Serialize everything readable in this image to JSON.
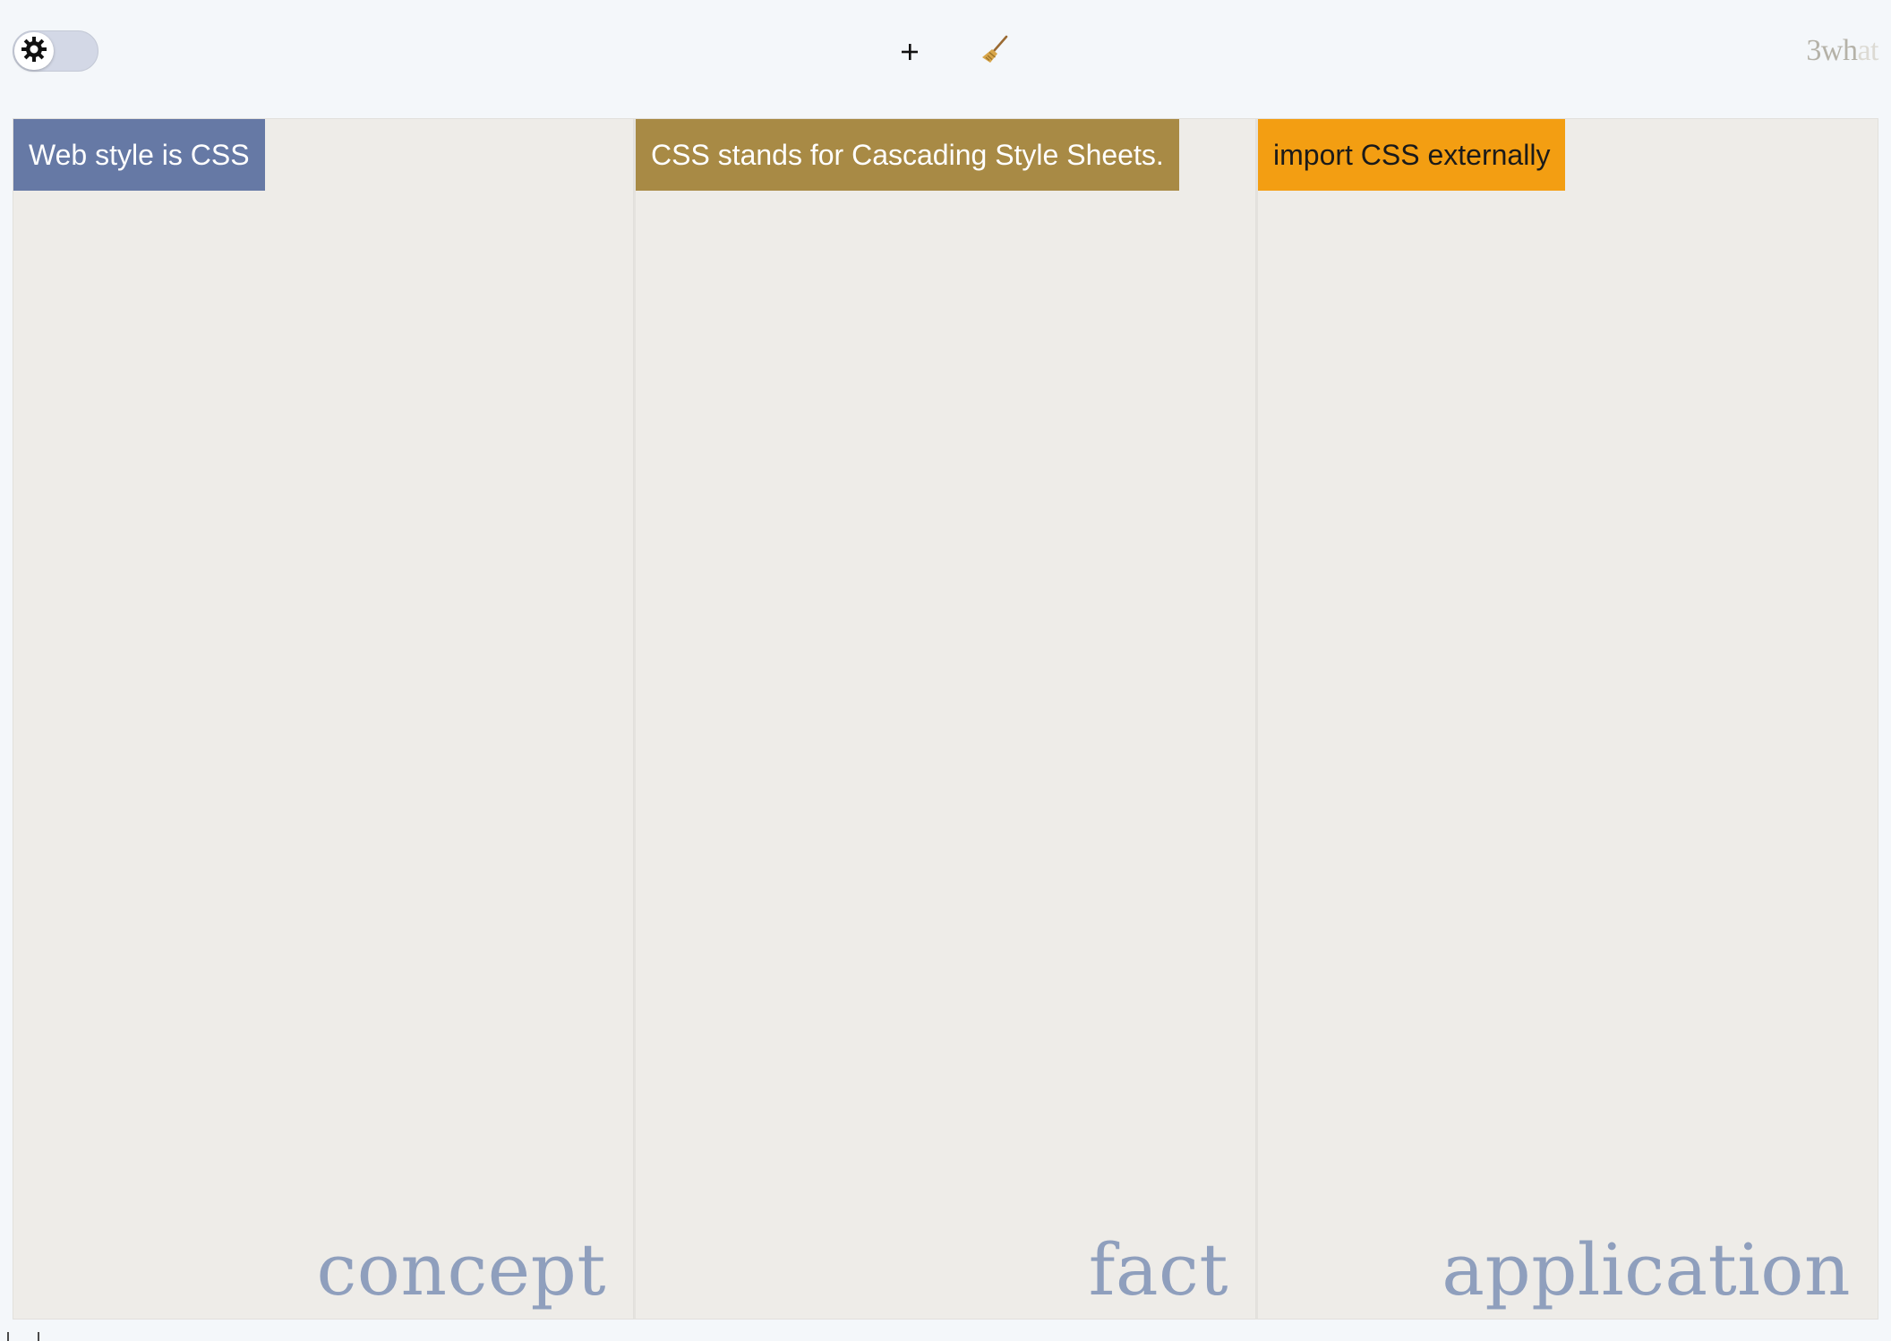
{
  "toolbar": {
    "theme_toggle": {
      "icon": "gear-icon",
      "state": "light"
    },
    "add_button": {
      "label": "+"
    },
    "clear_button": {
      "icon": "broom-icon",
      "glyph": "🧹"
    },
    "brand": {
      "strong": "3wh",
      "faded": "at"
    }
  },
  "columns": [
    {
      "label": "concept",
      "cards": [
        {
          "text": "Web style is CSS",
          "bg": "#6679a5",
          "fg": "#ffffff"
        }
      ]
    },
    {
      "label": "fact",
      "cards": [
        {
          "text": "CSS stands for Cascading Style Sheets.",
          "bg": "#a88a45",
          "fg": "#ffffff"
        }
      ]
    },
    {
      "label": "application",
      "cards": [
        {
          "text": "import CSS externally",
          "bg": "#f39e12",
          "fg": "#1a1a1a"
        }
      ]
    }
  ],
  "colors": {
    "column_bg": "#eeece8",
    "column_label": "#8f9fbd",
    "page_bg": "#f4f7fa"
  }
}
